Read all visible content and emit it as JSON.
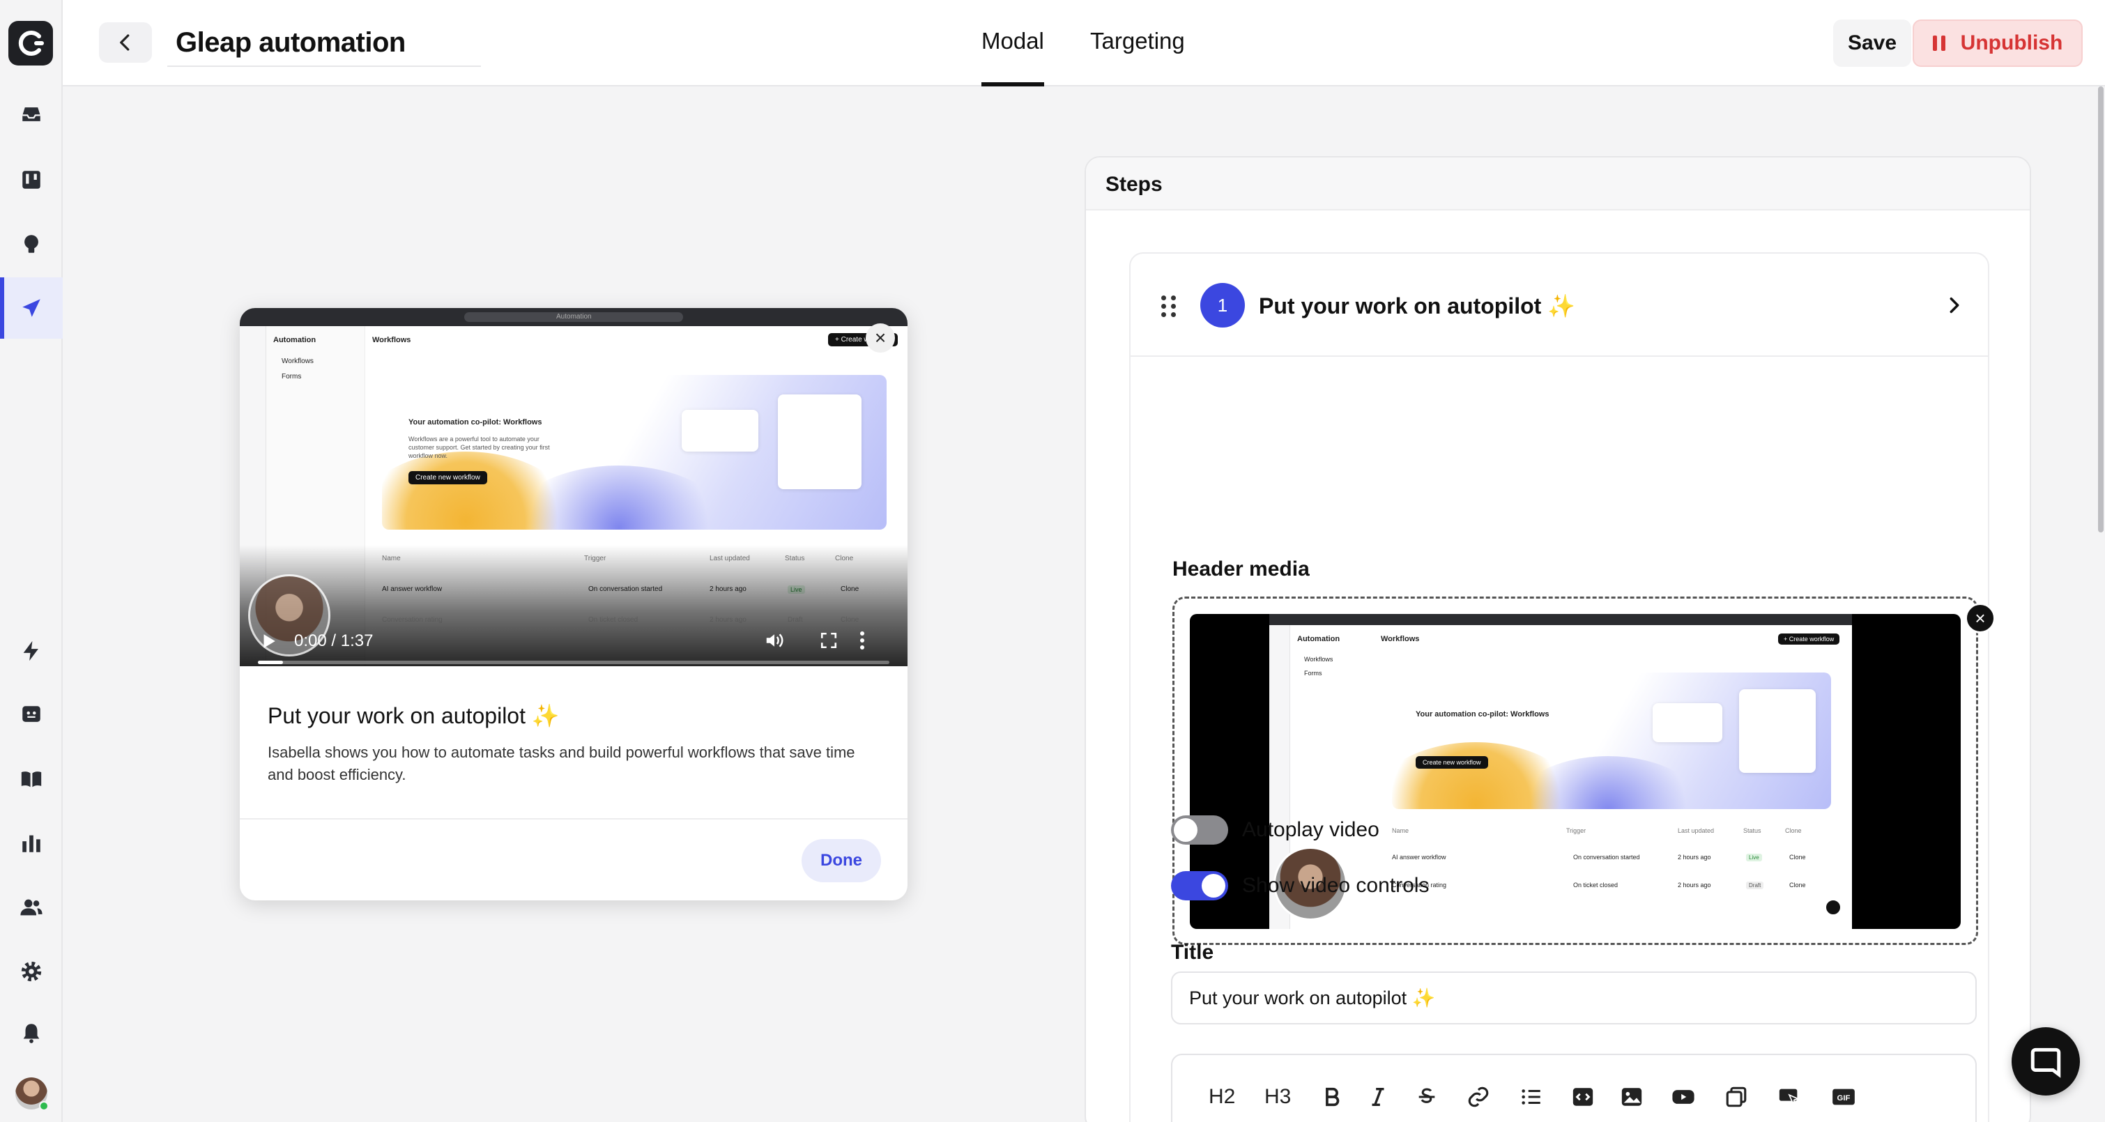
{
  "app": {
    "automation_name": "Gleap automation",
    "colors": {
      "accent": "#3b47e0",
      "danger": "#d63434",
      "sidebar_bg": "#f4f4f5"
    }
  },
  "sidebar": {
    "items": [
      {
        "icon": "inbox-icon"
      },
      {
        "icon": "kanban-icon"
      },
      {
        "icon": "lightbulb-icon"
      },
      {
        "icon": "paper-plane-icon",
        "active": true
      },
      {
        "icon": "bolt-icon"
      },
      {
        "icon": "bot-icon"
      },
      {
        "icon": "book-icon"
      },
      {
        "icon": "bar-chart-icon"
      },
      {
        "icon": "users-icon"
      },
      {
        "icon": "gear-icon"
      },
      {
        "icon": "bell-icon"
      }
    ]
  },
  "header": {
    "tabs": [
      {
        "label": "Modal",
        "active": true
      },
      {
        "label": "Targeting",
        "active": false
      }
    ],
    "save_label": "Save",
    "unpublish_label": "Unpublish"
  },
  "preview": {
    "video_time": "0:00 / 1:37",
    "progress": 0.0,
    "title": "Put your work on autopilot ✨",
    "body": "Isabella shows you how to automate tasks and build powerful workflows that save time and boost efficiency.",
    "done_label": "Done",
    "embedded": {
      "window_title": "Automation",
      "app_label": "Automation",
      "page_label": "Workflows",
      "nav_items": [
        "Workflows",
        "Forms"
      ],
      "create_label": "+ Create workflow",
      "hero_title": "Your automation co-pilot: Workflows",
      "hero_body": "Workflows are a powerful tool to automate your customer support. Get started by creating your first workflow now.",
      "hero_button": "Create new workflow",
      "columns": [
        "Name",
        "Trigger",
        "Last updated",
        "Status",
        "Clone"
      ],
      "rows": [
        {
          "name": "AI answer workflow",
          "trigger": "On conversation started",
          "updated": "2 hours ago",
          "status": "Live",
          "clone": "Clone"
        },
        {
          "name": "Conversation rating",
          "trigger": "On ticket closed",
          "updated": "2 hours ago",
          "status": "Draft",
          "clone": "Clone"
        }
      ]
    }
  },
  "steps": {
    "title": "Steps",
    "step": {
      "number": "1",
      "name": "Put your work on autopilot ✨",
      "header_media_label": "Header media",
      "autoplay_label": "Autoplay video",
      "autoplay_on": false,
      "controls_label": "Show video controls",
      "controls_on": true,
      "title_label": "Title",
      "title_value": "Put your work on autopilot ✨",
      "toolbar": [
        "H2",
        "H3"
      ]
    }
  }
}
